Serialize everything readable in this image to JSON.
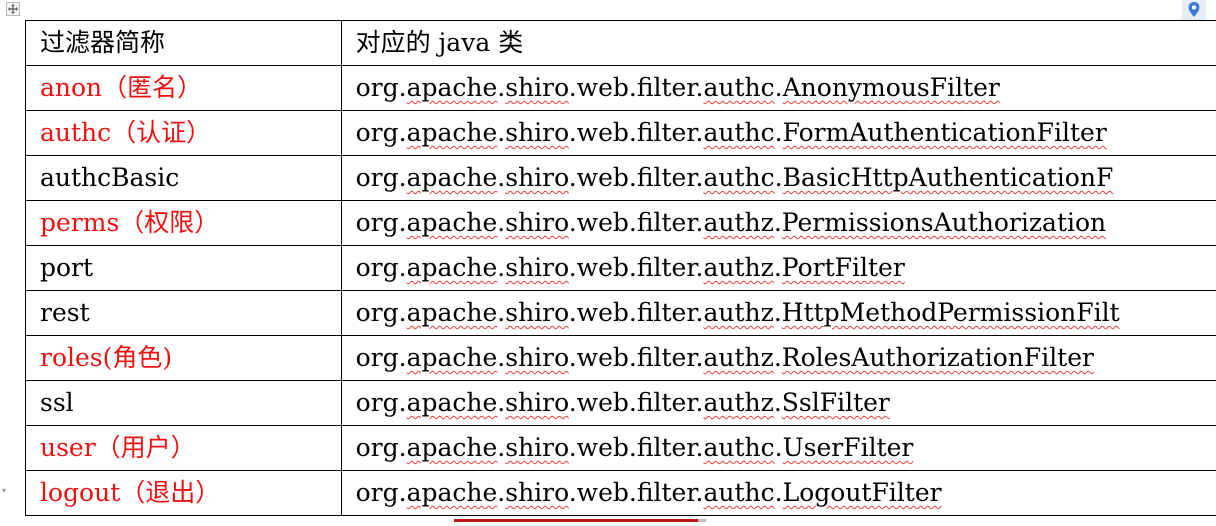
{
  "table": {
    "header": {
      "filter_name": "过滤器简称",
      "java_class": "对应的 java 类"
    },
    "rows": [
      {
        "name": "anon（匿名）",
        "pkg_a": "org.",
        "pkg_b": "apache",
        "pkg_c": ".",
        "pkg_d": "shiro",
        "pkg_e": ".web.filter.",
        "pkg_f": "authc",
        "pkg_g": ".",
        "pkg_h": "AnonymousFilter",
        "highlight": true
      },
      {
        "name": "authc（认证）",
        "pkg_a": "org.",
        "pkg_b": "apache",
        "pkg_c": ".",
        "pkg_d": "shiro",
        "pkg_e": ".web.filter.",
        "pkg_f": "authc",
        "pkg_g": ".",
        "pkg_h": "FormAuthenticationFilter",
        "highlight": true
      },
      {
        "name": "authcBasic",
        "pkg_a": "org.",
        "pkg_b": "apache",
        "pkg_c": ".",
        "pkg_d": "shiro",
        "pkg_e": ".web.filter.",
        "pkg_f": "authc",
        "pkg_g": ".",
        "pkg_h": "BasicHttpAuthenticationF",
        "highlight": false
      },
      {
        "name": "perms（权限）",
        "pkg_a": "org.",
        "pkg_b": "apache",
        "pkg_c": ".",
        "pkg_d": "shiro",
        "pkg_e": ".web.filter.",
        "pkg_f": "authz",
        "pkg_g": ".",
        "pkg_h": "PermissionsAuthorization",
        "highlight": true
      },
      {
        "name": "port",
        "pkg_a": "org.",
        "pkg_b": "apache",
        "pkg_c": ".",
        "pkg_d": "shiro",
        "pkg_e": ".web.filter.",
        "pkg_f": "authz",
        "pkg_g": ".",
        "pkg_h": "PortFilter",
        "highlight": false
      },
      {
        "name": "rest",
        "pkg_a": "org.",
        "pkg_b": "apache",
        "pkg_c": ".",
        "pkg_d": "shiro",
        "pkg_e": ".web.filter.",
        "pkg_f": "authz",
        "pkg_g": ".",
        "pkg_h": "HttpMethodPermissionFilt",
        "highlight": false
      },
      {
        "name": "roles(角色)",
        "pkg_a": "org.",
        "pkg_b": "apache",
        "pkg_c": ".",
        "pkg_d": "shiro",
        "pkg_e": ".web.filter.",
        "pkg_f": "authz",
        "pkg_g": ".",
        "pkg_h": "RolesAuthorizationFilter",
        "highlight": true
      },
      {
        "name": "ssl",
        "pkg_a": "org.",
        "pkg_b": "apache",
        "pkg_c": ".",
        "pkg_d": "shiro",
        "pkg_e": ".web.filter.",
        "pkg_f": "authz",
        "pkg_g": ".",
        "pkg_h": "SslFilter",
        "highlight": false
      },
      {
        "name": "user（用户）",
        "pkg_a": "org.",
        "pkg_b": "apache",
        "pkg_c": ".",
        "pkg_d": "shiro",
        "pkg_e": ".web.filter.",
        "pkg_f": "authc",
        "pkg_g": ".",
        "pkg_h": "UserFilter",
        "highlight": true
      },
      {
        "name": "logout（退出）",
        "pkg_a": "org.",
        "pkg_b": "apache",
        "pkg_c": ".",
        "pkg_d": "shiro",
        "pkg_e": ".web.filter.",
        "pkg_f": "authc",
        "pkg_g": ".",
        "pkg_h": "LogoutFilter",
        "highlight": true
      }
    ]
  },
  "colors": {
    "highlight_text": "#ee1111",
    "spellcheck_underline": "#e04040",
    "anchor_icon": "#3a7bd5"
  },
  "icons": {
    "table_move_handle": "move-arrows-icon",
    "anchor": "location-pin-icon"
  }
}
